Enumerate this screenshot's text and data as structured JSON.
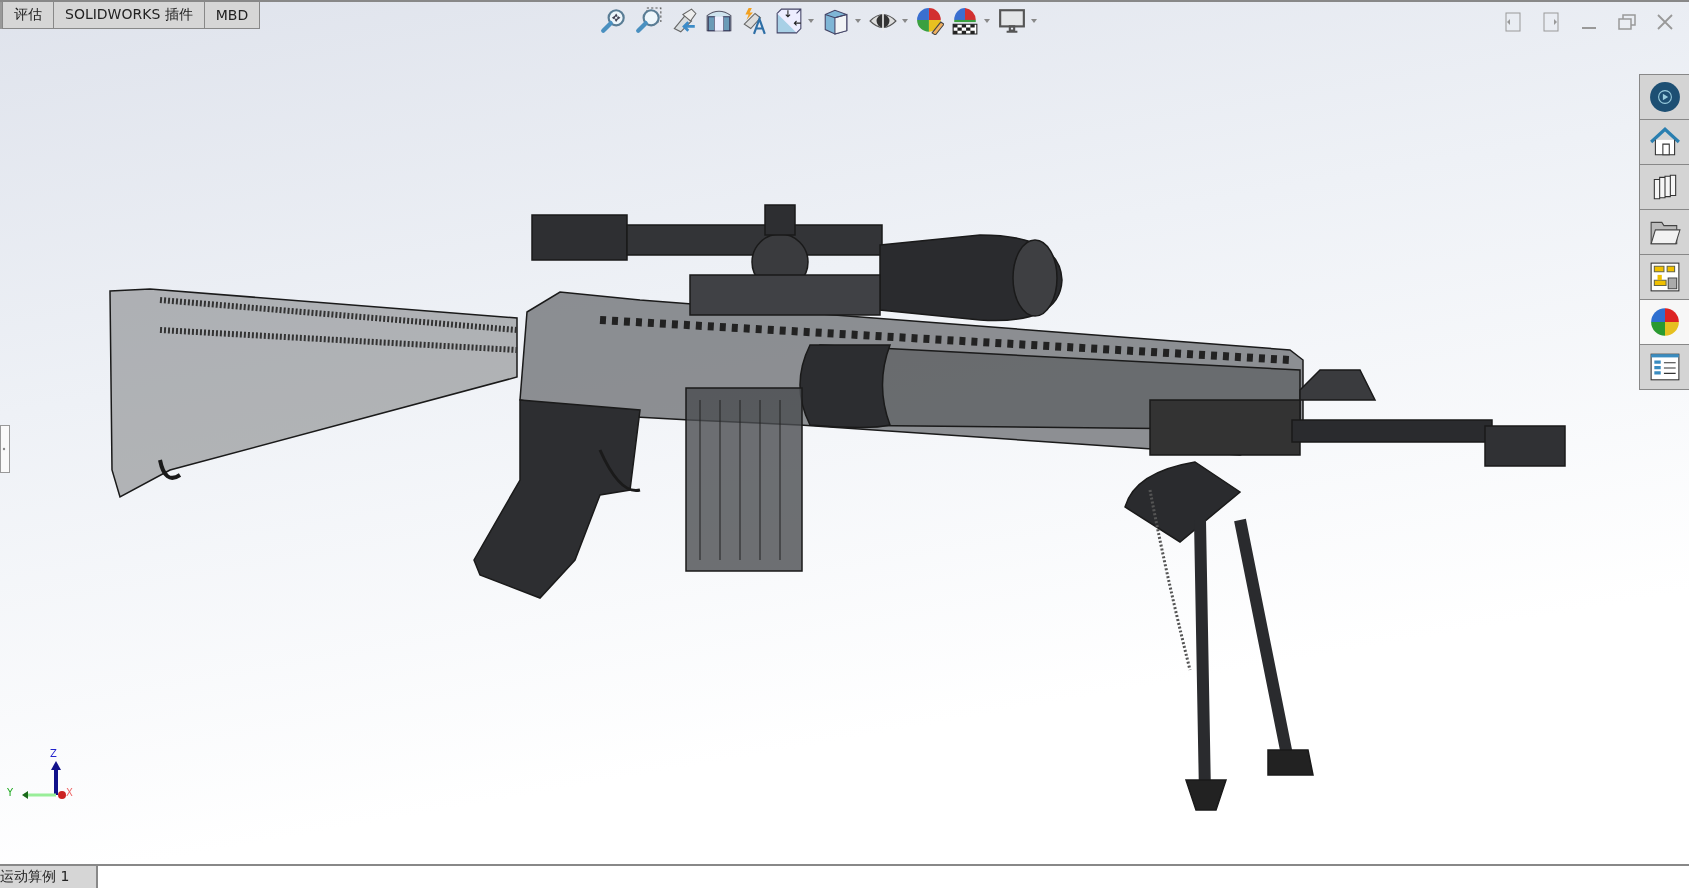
{
  "command_tabs": [
    {
      "label": "评估"
    },
    {
      "label": "SOLIDWORKS 插件"
    },
    {
      "label": "MBD"
    }
  ],
  "task_pane_tabs": [
    {
      "kind": "globe",
      "selected": false
    },
    {
      "kind": "home",
      "selected": false
    },
    {
      "kind": "library",
      "selected": false
    },
    {
      "kind": "folder",
      "selected": false
    },
    {
      "kind": "palette",
      "selected": false
    },
    {
      "kind": "appearance",
      "selected": true
    },
    {
      "kind": "properties",
      "selected": false
    }
  ],
  "triad": {
    "z": "Z",
    "y": "Y",
    "x": "X"
  },
  "bottom_tabs": [
    {
      "label": "运动算例 1"
    }
  ]
}
